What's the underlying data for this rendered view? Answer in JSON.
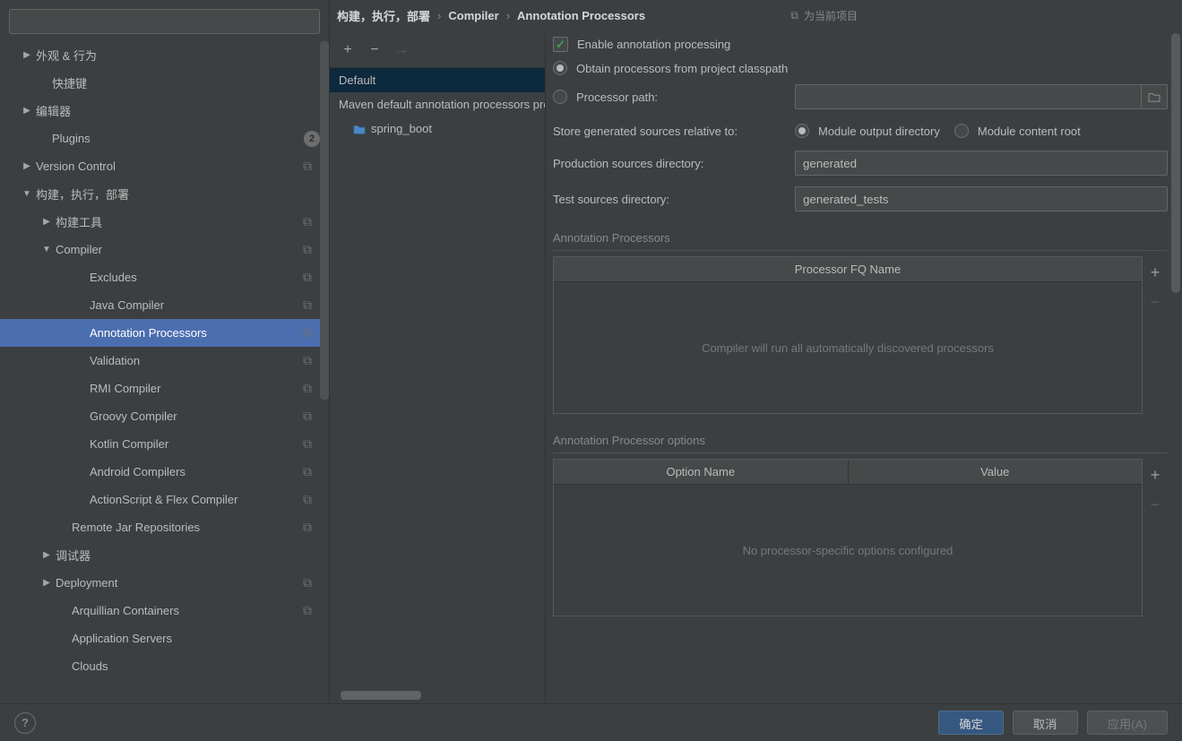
{
  "sidebar": {
    "search_placeholder": "",
    "items": [
      {
        "label": "外观 & 行为",
        "arrow": "▶",
        "indent": 24,
        "badge": "",
        "count": ""
      },
      {
        "label": "快捷键",
        "arrow": "",
        "indent": 42,
        "badge": "",
        "count": ""
      },
      {
        "label": "编辑器",
        "arrow": "▶",
        "indent": 24,
        "badge": "",
        "count": ""
      },
      {
        "label": "Plugins",
        "arrow": "",
        "indent": 42,
        "badge": "",
        "count": "2"
      },
      {
        "label": "Version Control",
        "arrow": "▶",
        "indent": 24,
        "badge": "⧉",
        "count": ""
      },
      {
        "label": "构建，执行，部署",
        "arrow": "▼",
        "indent": 24,
        "badge": "",
        "count": ""
      },
      {
        "label": "构建工具",
        "arrow": "▶",
        "indent": 46,
        "badge": "⧉",
        "count": ""
      },
      {
        "label": "Compiler",
        "arrow": "▼",
        "indent": 46,
        "badge": "⧉",
        "count": ""
      },
      {
        "label": "Excludes",
        "arrow": "",
        "indent": 84,
        "badge": "⧉",
        "count": ""
      },
      {
        "label": "Java Compiler",
        "arrow": "",
        "indent": 84,
        "badge": "⧉",
        "count": ""
      },
      {
        "label": "Annotation Processors",
        "arrow": "",
        "indent": 84,
        "badge": "⧉",
        "count": "",
        "selected": true
      },
      {
        "label": "Validation",
        "arrow": "",
        "indent": 84,
        "badge": "⧉",
        "count": ""
      },
      {
        "label": "RMI Compiler",
        "arrow": "",
        "indent": 84,
        "badge": "⧉",
        "count": ""
      },
      {
        "label": "Groovy Compiler",
        "arrow": "",
        "indent": 84,
        "badge": "⧉",
        "count": ""
      },
      {
        "label": "Kotlin Compiler",
        "arrow": "",
        "indent": 84,
        "badge": "⧉",
        "count": ""
      },
      {
        "label": "Android Compilers",
        "arrow": "",
        "indent": 84,
        "badge": "⧉",
        "count": ""
      },
      {
        "label": "ActionScript & Flex Compiler",
        "arrow": "",
        "indent": 84,
        "badge": "⧉",
        "count": ""
      },
      {
        "label": "Remote Jar Repositories",
        "arrow": "",
        "indent": 64,
        "badge": "⧉",
        "count": ""
      },
      {
        "label": "调试器",
        "arrow": "▶",
        "indent": 46,
        "badge": "",
        "count": ""
      },
      {
        "label": "Deployment",
        "arrow": "▶",
        "indent": 46,
        "badge": "⧉",
        "count": ""
      },
      {
        "label": "Arquillian Containers",
        "arrow": "",
        "indent": 64,
        "badge": "⧉",
        "count": ""
      },
      {
        "label": "Application Servers",
        "arrow": "",
        "indent": 64,
        "badge": "",
        "count": ""
      },
      {
        "label": "Clouds",
        "arrow": "",
        "indent": 64,
        "badge": "",
        "count": ""
      }
    ]
  },
  "profiles": {
    "items": [
      {
        "label": "Default",
        "selected": true
      },
      {
        "label": "Maven default annotation processors profile"
      },
      {
        "label": "spring_boot",
        "child": true
      }
    ]
  },
  "breadcrumb": {
    "root": "构建，执行，部署",
    "mid": "Compiler",
    "leaf": "Annotation Processors",
    "project_icon": "⧉",
    "project_label": "为当前项目"
  },
  "form": {
    "enable_label": "Enable annotation processing",
    "obtain_label": "Obtain processors from project classpath",
    "processor_path_label": "Processor path:",
    "processor_path_value": "",
    "store_label": "Store generated sources relative to:",
    "store_opt1": "Module output directory",
    "store_opt2": "Module content root",
    "prod_dir_label": "Production sources directory:",
    "prod_dir_value": "generated",
    "test_dir_label": "Test sources directory:",
    "test_dir_value": "generated_tests"
  },
  "processors_table": {
    "title": "Annotation Processors",
    "header": "Processor FQ Name",
    "empty": "Compiler will run all automatically discovered processors"
  },
  "options_table": {
    "title": "Annotation Processor options",
    "col1": "Option Name",
    "col2": "Value",
    "empty": "No processor-specific options configured"
  },
  "footer": {
    "ok": "确定",
    "cancel": "取消",
    "apply": "应用(A)"
  }
}
